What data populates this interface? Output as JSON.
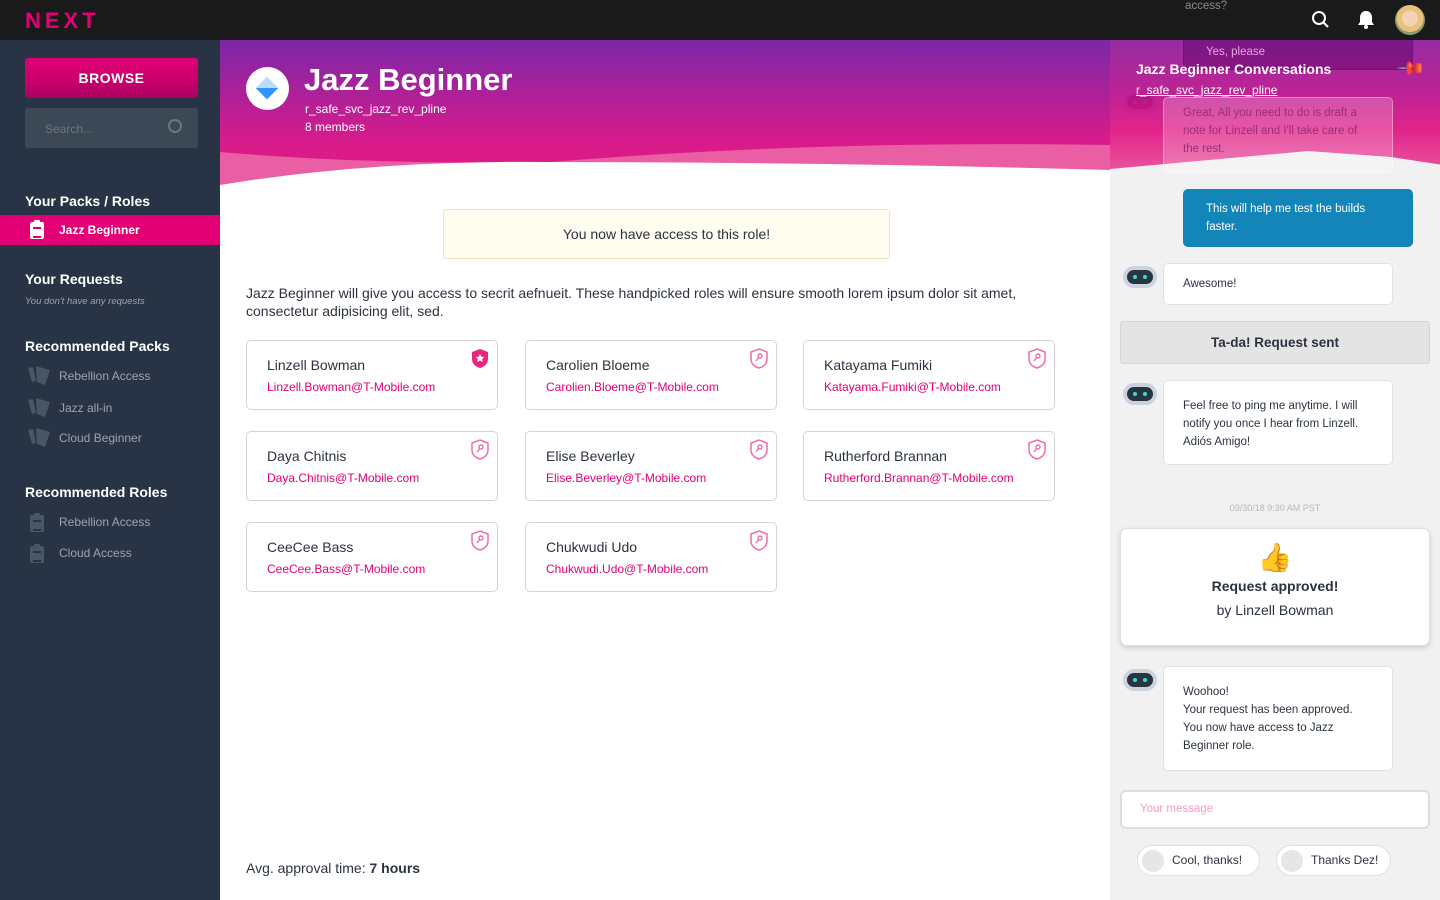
{
  "app": {
    "logo": "NEXT"
  },
  "sidebar": {
    "browse": "BROWSE",
    "search_placeholder": "Search...",
    "packs_heading": "Your Packs / Roles",
    "active_item": "Jazz Beginner",
    "requests_heading": "Your Requests",
    "requests_note": "You don't have any requests",
    "rec_packs_heading": "Recommended Packs",
    "rec_packs": [
      "Rebellion Access",
      "Jazz all-in",
      "Cloud Beginner"
    ],
    "rec_roles_heading": "Recommended Roles",
    "rec_roles": [
      "Rebellion Access",
      "Cloud Access"
    ]
  },
  "role": {
    "title": "Jazz Beginner",
    "id": "r_safe_svc_jazz_rev_pline",
    "members": "8 members",
    "notice": "You now have access to this role!",
    "description": "Jazz Beginner will give you access to secrit aefnueit. These handpicked roles will ensure smooth lorem ipsum dolor sit amet, consectetur adipisicing elit, sed.",
    "avg_label": "Avg. approval time: ",
    "avg_value": "7 hours"
  },
  "members": [
    {
      "name": "Linzell Bowman",
      "email": "Linzell.Bowman@T-Mobile.com",
      "badge": "owner-star-shield"
    },
    {
      "name": "Carolien Bloeme",
      "email": "Carolien.Bloeme@T-Mobile.com",
      "badge": "key-shield"
    },
    {
      "name": "Katayama Fumiki",
      "email": "Katayama.Fumiki@T-Mobile.com",
      "badge": "key-shield"
    },
    {
      "name": "Daya Chitnis",
      "email": "Daya.Chitnis@T-Mobile.com",
      "badge": "key-shield"
    },
    {
      "name": "Elise Beverley",
      "email": "Elise.Beverley@T-Mobile.com",
      "badge": "key-shield"
    },
    {
      "name": "Rutherford Brannan",
      "email": "Rutherford.Brannan@T-Mobile.com",
      "badge": "key-shield"
    },
    {
      "name": "CeeCee Bass",
      "email": "CeeCee.Bass@T-Mobile.com",
      "badge": "key-shield"
    },
    {
      "name": "Chukwudi Udo",
      "email": "Chukwudi.Udo@T-Mobile.com",
      "badge": "key-shield"
    }
  ],
  "chat": {
    "title": "Jazz Beginner Conversations",
    "link": "r_safe_svc_jazz_rev_pline",
    "m_access": "access?",
    "m_yes": "Yes, please",
    "m_great": "Great, All you need to do is draft a note for Linzell and I'll take care of the rest.",
    "m_user": "This will help me test the builds faster.",
    "m_awesome": "Awesome!",
    "m_sent": "Ta-da! Request sent",
    "m_ping": "Feel free to ping me anytime. I will notify you once I hear from Linzell. Adiós Amigo!",
    "timestamp": "09/30/18 9:30 AM PST",
    "approved_emoji": "👍",
    "approved_title": "Request approved!",
    "approved_by": "by Linzell Bowman",
    "m_woohoo": [
      "Woohoo!",
      "Your request has been approved.",
      "You now have access to Jazz Beginner role."
    ],
    "input_placeholder": "Your message",
    "quick_replies": [
      "Cool, thanks!",
      "Thanks Dez!"
    ]
  },
  "colors": {
    "brand": "#e20074",
    "sidebar": "#283445",
    "user_bubble": "#1385b8"
  }
}
